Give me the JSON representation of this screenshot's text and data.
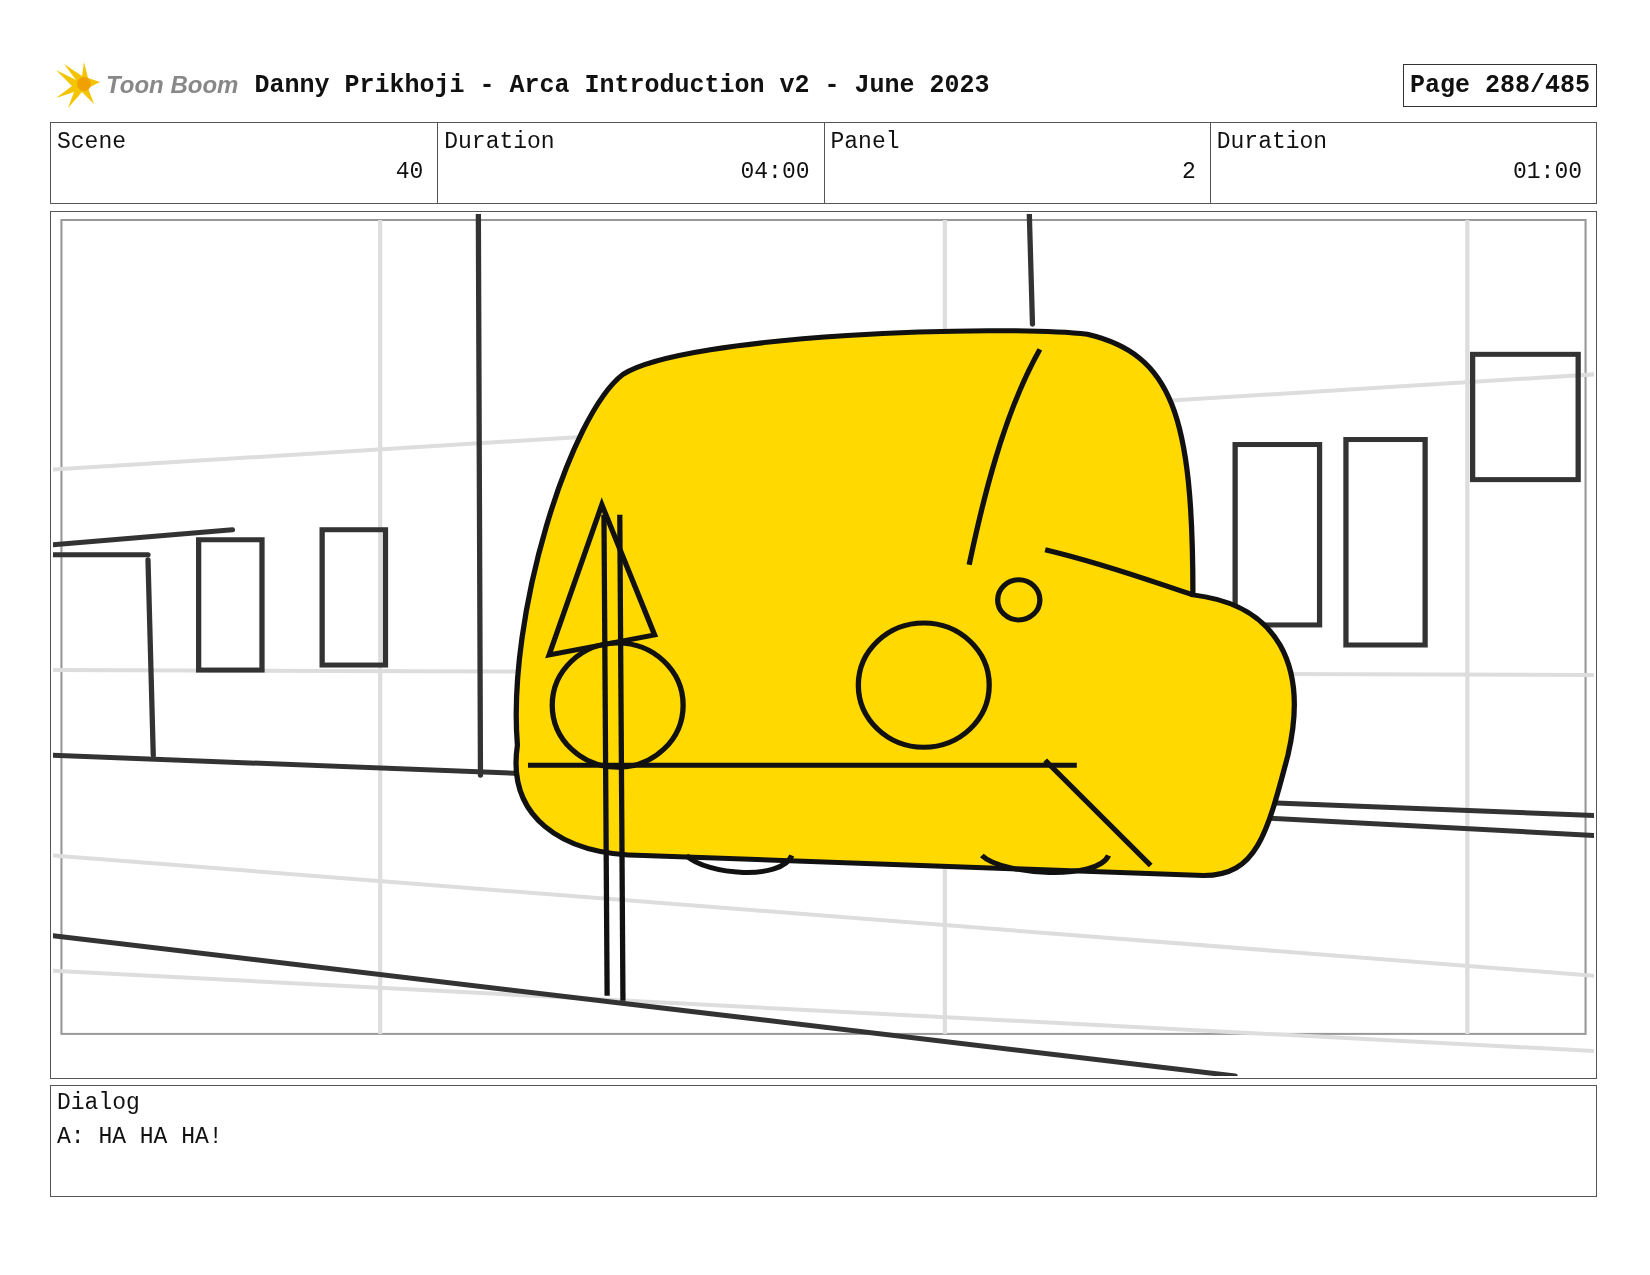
{
  "header": {
    "logo_text": "Toon Boom",
    "title": "Danny Prikhoji - Arca Introduction v2 - June 2023",
    "page": "Page 288/485"
  },
  "fields": [
    {
      "label": "Scene",
      "value": "40"
    },
    {
      "label": "Duration",
      "value": "04:00"
    },
    {
      "label": "Panel",
      "value": "2"
    },
    {
      "label": "Duration",
      "value": "01:00"
    }
  ],
  "dialog": {
    "label": "Dialog",
    "text": "A: HA HA HA!"
  }
}
